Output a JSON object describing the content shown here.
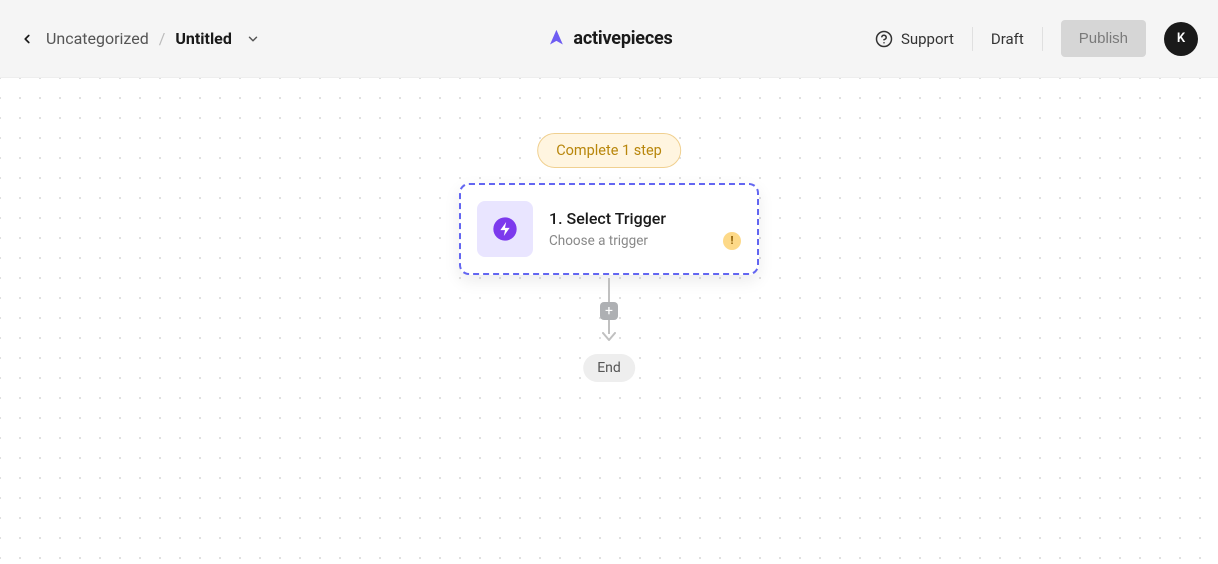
{
  "header": {
    "breadcrumb": {
      "category": "Uncategorized",
      "separator": "/",
      "title": "Untitled"
    },
    "logo_text": "activepieces",
    "support_label": "Support",
    "status": "Draft",
    "publish_label": "Publish",
    "avatar_initial": "K"
  },
  "canvas": {
    "complete_pill": "Complete 1 step",
    "trigger": {
      "title": "1. Select Trigger",
      "subtitle": "Choose a trigger",
      "warn": "!"
    },
    "add_symbol": "+",
    "end_label": "End"
  }
}
